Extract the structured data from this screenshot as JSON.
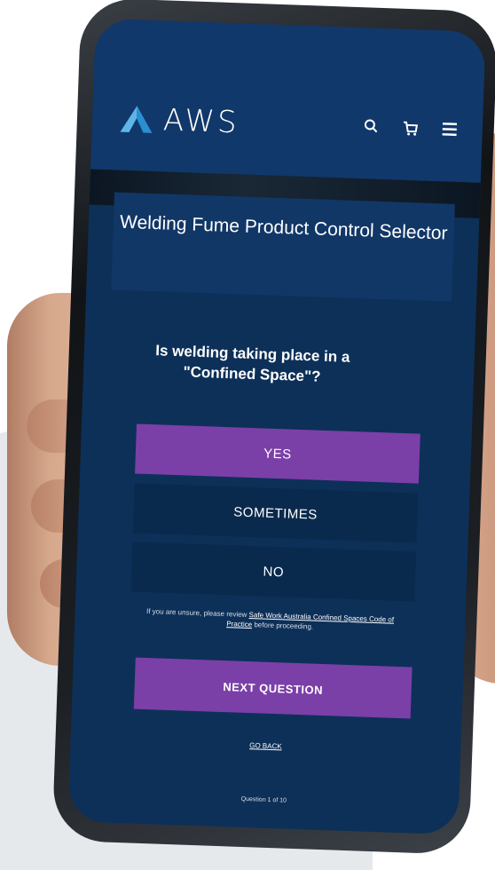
{
  "header": {
    "brand": "AWS",
    "icons": [
      "search-icon",
      "cart-icon",
      "menu-icon"
    ]
  },
  "title": "Welding Fume Product Control Selector",
  "question": "Is welding taking place in a \"Confined Space\"?",
  "options": [
    {
      "label": "YES",
      "selected": true
    },
    {
      "label": "SOMETIMES",
      "selected": false
    },
    {
      "label": "NO",
      "selected": false
    }
  ],
  "note": {
    "prefix": "If you are unsure, please review ",
    "link": "Safe Work Australia Confined Spaces Code of Practice",
    "suffix": " before proceeding."
  },
  "next_label": "NEXT QUESTION",
  "back_label": "GO BACK",
  "counter": "Question 1 of 10",
  "colors": {
    "screen_bg": "#0d3058",
    "accent": "#7b3fa8",
    "option_bg": "#0a2a4d"
  }
}
